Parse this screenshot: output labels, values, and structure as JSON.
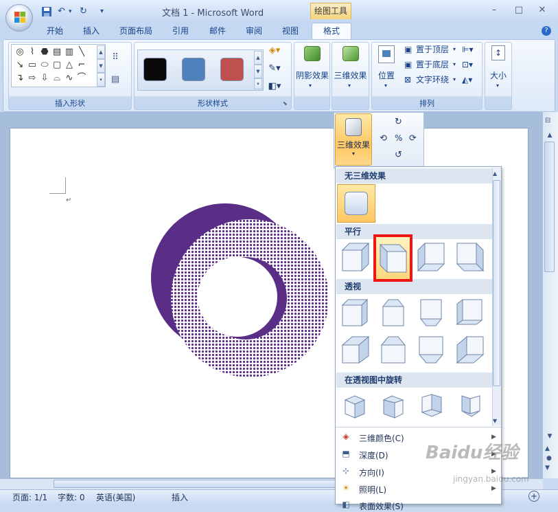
{
  "window": {
    "title": "文档 1 - Microsoft Word",
    "context_tab": "绘图工具",
    "controls": [
      "–",
      "□",
      "✕"
    ]
  },
  "tabs": [
    "开始",
    "插入",
    "页面布局",
    "引用",
    "邮件",
    "审阅",
    "视图",
    "格式"
  ],
  "qat_icons": [
    "save-icon",
    "undo-icon",
    "redo-icon",
    "customize-icon"
  ],
  "ribbon": {
    "groups": {
      "insert_shapes": "插入形状",
      "shape_styles": "形状样式",
      "arrange": "排列"
    },
    "shadow_label": "阴影效果",
    "threed_label": "三维效果",
    "position_label": "位置",
    "size_label": "大小",
    "arrange_items": [
      "置于顶层",
      "置于底层",
      "文字环绕"
    ],
    "swatches": [
      "#0a0a0a",
      "#4f81bd",
      "#c0504d"
    ]
  },
  "popup": {
    "label": "三维效果"
  },
  "gallery": {
    "no3d": "无三维效果",
    "parallel": "平行",
    "perspective": "透视",
    "rotate_perspective": "在透视图中旋转",
    "menu": [
      "三维颜色(C)",
      "深度(D)",
      "方向(I)",
      "照明(L)",
      "表面效果(S)"
    ]
  },
  "status": {
    "page": "页面: 1/1",
    "words": "字数: 0",
    "language": "英语(美国)",
    "mode": "插入"
  },
  "watermark": {
    "main": "Baidu经验",
    "sub": "jingyan.baidu.com"
  },
  "colors": {
    "accent": "#ffc762",
    "ring": "#5a2d86",
    "highlight": "#f01414"
  }
}
